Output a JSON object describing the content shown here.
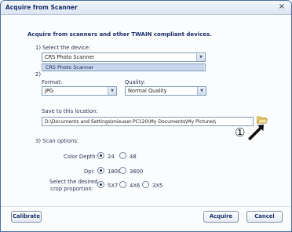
{
  "window": {
    "title": "Acquire from Scanner",
    "close_glyph": "×"
  },
  "heading": "Acquire from scanners and other TWAIN compliant devices.",
  "step1": {
    "label": "1) Select the device:",
    "selected": "CRS Photo Scanner",
    "list_item": "CRS Photo Scanner"
  },
  "step2": {
    "label_partial": "2)",
    "format_label": "Format:",
    "format_value": "JPG",
    "quality_label": "Quality:",
    "quality_value": "Normal Quality",
    "save_label": "Save to this location:",
    "save_path": "D:\\Documents and Settings\\mieuser.PC120\\My Documents\\My Pictures\\",
    "annotation_number": "①"
  },
  "step3": {
    "label": "3) Scan options:",
    "color_depth_label": "Color Depth:",
    "color_depth_options": [
      "24",
      "48"
    ],
    "color_depth_selected": "24",
    "dpi_label": "Dpi:",
    "dpi_options": [
      "1800",
      "3600"
    ],
    "dpi_selected": "1800",
    "crop_label_line1": "Select the desired",
    "crop_label_line2": "crop proportion:",
    "crop_options": [
      "5X7",
      "4X6",
      "3X5"
    ],
    "crop_selected": "5X7"
  },
  "buttons": {
    "calibrate": "Calibrate",
    "acquire": "Acquire",
    "cancel": "Cancel"
  },
  "colors": {
    "title_text": "#1b2f6b",
    "border": "#4a6ea8",
    "selection": "#c9d7ee"
  }
}
